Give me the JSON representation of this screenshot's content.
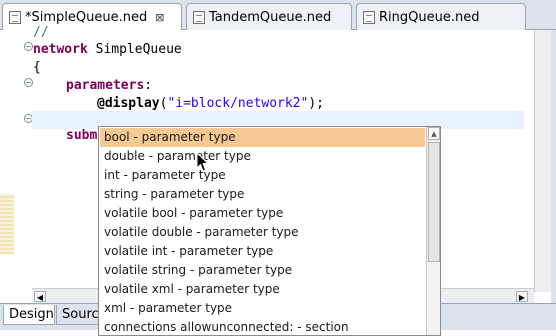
{
  "tabs": [
    {
      "label": "*SimpleQueue.ned",
      "close": "⊠",
      "active": true
    },
    {
      "label": "TandemQueue.ned",
      "active": false
    },
    {
      "label": "RingQueue.ned",
      "active": false
    }
  ],
  "code": {
    "line0": "//",
    "kw_network": "network",
    "network_name": " SimpleQueue",
    "brace_open": "{",
    "kw_parameters": "parameters",
    "colon": ":",
    "display_kw": "@display",
    "paren_open": "(",
    "display_str": "\"i=block/network2\"",
    "paren_close": ");",
    "submodules_partial": "subm"
  },
  "popup": {
    "items": [
      "bool - parameter type",
      "double - parameter type",
      "int - parameter type",
      "string - parameter type",
      "volatile bool - parameter type",
      "volatile double - parameter type",
      "volatile int - parameter type",
      "volatile string - parameter type",
      "volatile xml - parameter type",
      "xml - parameter type",
      "connections allowunconnected: - section"
    ],
    "selected_index": 0
  },
  "bottom_tabs": [
    {
      "label": "Design",
      "active": true
    },
    {
      "label": "Source",
      "active": false
    }
  ],
  "colors": {
    "keyword": "#7f0055",
    "string": "#2a00ff",
    "comment": "#3f7f5f",
    "selection": "#f4c994",
    "current_line": "#e8f2fe"
  }
}
